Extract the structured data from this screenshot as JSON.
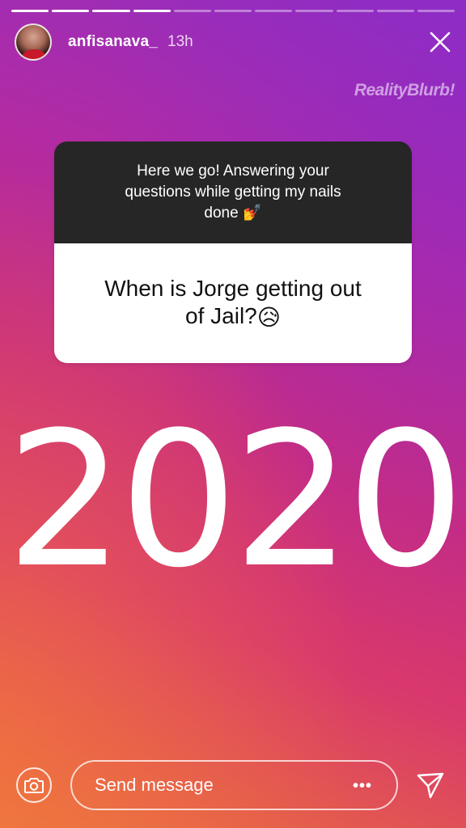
{
  "progress": {
    "segments": 11,
    "completed": 4
  },
  "header": {
    "username": "anfisanava_",
    "time_ago": "13h",
    "close_icon": "close-icon"
  },
  "watermark": "RealityBlurb!",
  "sticker": {
    "prompt_line1": "Here we go! Answering your",
    "prompt_line2": "questions while getting my nails",
    "prompt_line3": "done",
    "prompt_emoji": "💅",
    "question_line1": "When is Jorge getting out",
    "question_line2": "of Jail?",
    "question_emoji": "😥"
  },
  "big_text": "2020",
  "footer": {
    "camera_icon": "camera-icon",
    "message_placeholder": "Send message",
    "more_label": "•••",
    "send_icon": "send-icon"
  },
  "colors": {
    "sticker_dark": "#262626",
    "sticker_light": "#ffffff",
    "gradient_top": "#8e2fc4",
    "gradient_bottom": "#ea7440"
  }
}
